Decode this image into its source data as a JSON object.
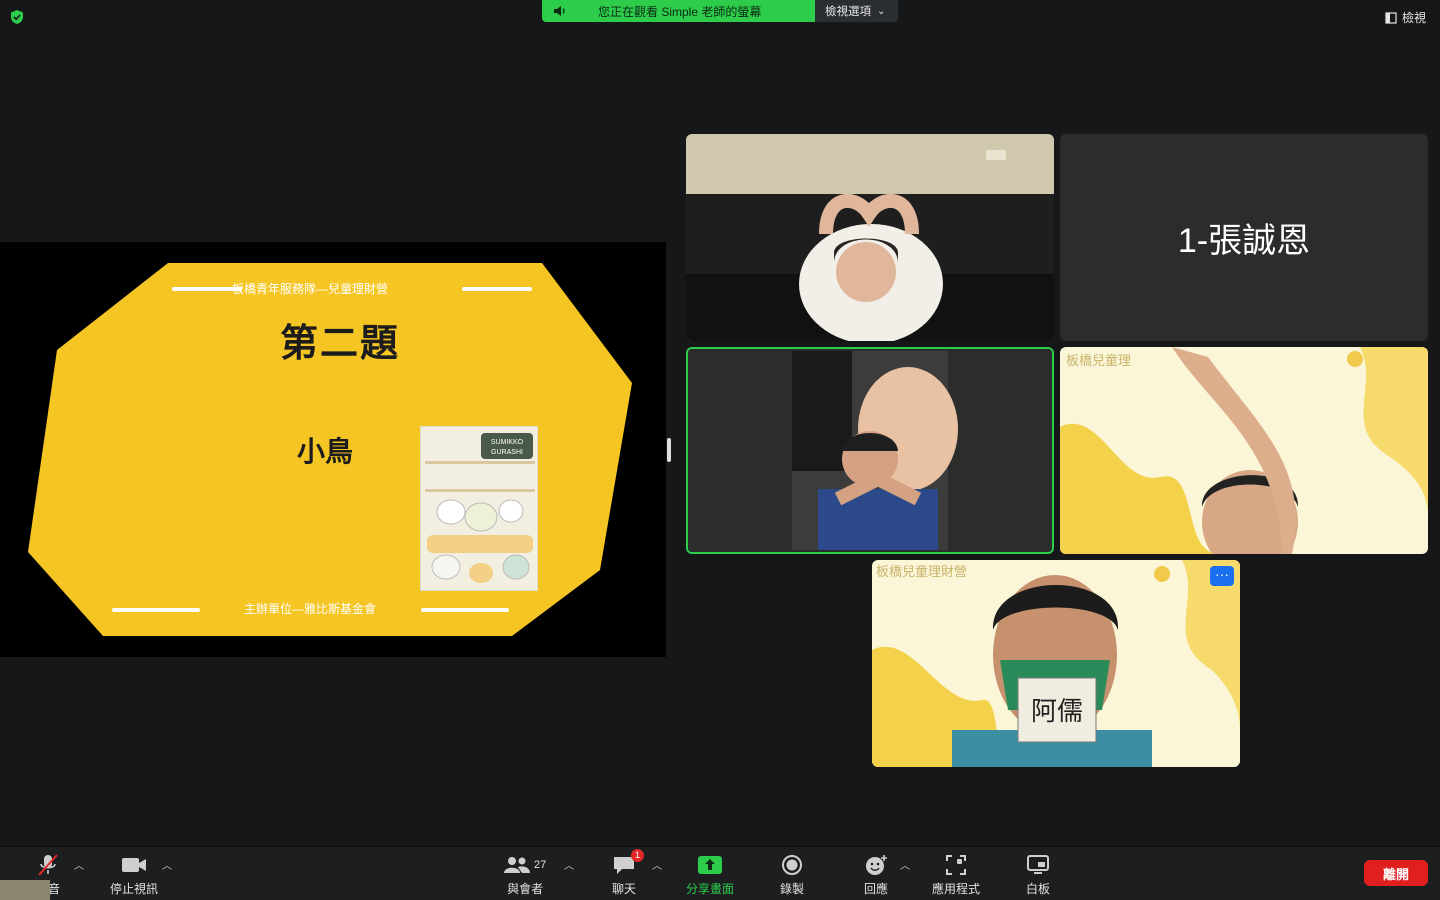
{
  "top_bar": {
    "share_status": "您正在觀看 Simple 老師的螢幕",
    "view_options": "檢視選項",
    "view_label": "檢視"
  },
  "slide": {
    "header": "板橋青年服務隊—兒童理財營",
    "title": "第ㄉ一ˋ二ㄦˋ題ㄊ一ˊ",
    "title_display": "第二題",
    "word": "小鳥",
    "footer": "主辦單位—雅比斯基金會",
    "poster_text": "SUMIKKO GURASHI"
  },
  "participants": [
    {
      "name": "",
      "type": "video"
    },
    {
      "name": "1-張誠恩",
      "type": "name-only"
    },
    {
      "name": "",
      "type": "video",
      "active": true
    },
    {
      "name": "",
      "type": "video"
    },
    {
      "name": "",
      "type": "video",
      "menu": "···"
    }
  ],
  "toolbar": {
    "mute": "靜音",
    "stop_video": "停止視訊",
    "participants": "與會者",
    "participants_count": "27",
    "chat": "聊天",
    "chat_badge": "1",
    "share_screen": "分享畫面",
    "record": "錄製",
    "reactions": "回應",
    "apps": "應用程式",
    "whiteboard": "白板",
    "leave": "離開"
  },
  "colors": {
    "accent_green": "#2dcc4b",
    "leave_red": "#e01f1f",
    "slide_yellow": "#f5c523"
  }
}
